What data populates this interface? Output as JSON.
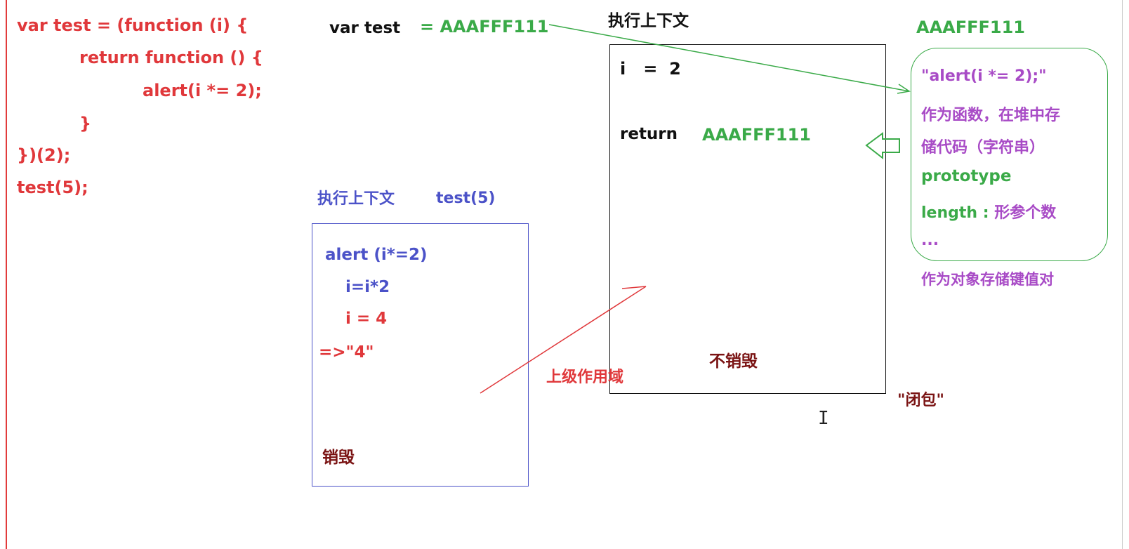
{
  "code": {
    "line1": "var test = (function (i) {",
    "line2": "return function () {",
    "line3": "alert(i *= 2);",
    "line4": "}",
    "line5": "})(2);",
    "line6": "test(5);"
  },
  "assign": {
    "var_label": "var test",
    "value": "= AAAFFF111"
  },
  "outer_context": {
    "title": "执行上下文",
    "i_line": "i   =  2",
    "return_label": "return",
    "return_value": "AAAFFF111",
    "note": "不销毁"
  },
  "closure_label": "\"闭包\"",
  "heap": {
    "address": "AAAFFF111",
    "code_string": "\"alert(i *= 2);\"",
    "desc_line1": "作为函数，在堆中存",
    "desc_line2": "储代码（字符串）",
    "prop_prototype": "prototype",
    "prop_length_key": "length :",
    "prop_length_desc": "形参个数",
    "ellipsis": "...",
    "footer": "作为对象存储键值对"
  },
  "inner_context": {
    "title": "执行上下文",
    "call": "test(5)",
    "line1": "alert (i*=2)",
    "line2": "i=i*2",
    "line3": "i = 4",
    "line4": "=>\"4\"",
    "note": "销毁"
  },
  "scope_label": "上级作用域",
  "colors": {
    "code": "#e0383b",
    "green": "#3aaa48",
    "blue": "#4b52c8",
    "purple": "#a84bc6",
    "dark_red": "#7a1313"
  }
}
